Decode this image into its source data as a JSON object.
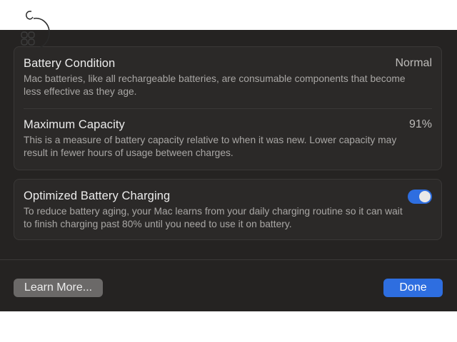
{
  "battery_condition": {
    "title": "Battery Condition",
    "value": "Normal",
    "description": "Mac batteries, like all rechargeable batteries, are consumable components that become less effective as they age."
  },
  "maximum_capacity": {
    "title": "Maximum Capacity",
    "value": "91%",
    "description": "This is a measure of battery capacity relative to when it was new. Lower capacity may result in fewer hours of usage between charges."
  },
  "optimized_charging": {
    "title": "Optimized Battery Charging",
    "enabled": true,
    "description": "To reduce battery aging, your Mac learns from your daily charging routine so it can wait to finish charging past 80% until you need to use it on battery."
  },
  "buttons": {
    "learn_more": "Learn More...",
    "done": "Done"
  },
  "colors": {
    "accent": "#2e6ee0",
    "sheet_background": "#252322"
  },
  "icons": {
    "logo": "apple-grid-logo"
  }
}
